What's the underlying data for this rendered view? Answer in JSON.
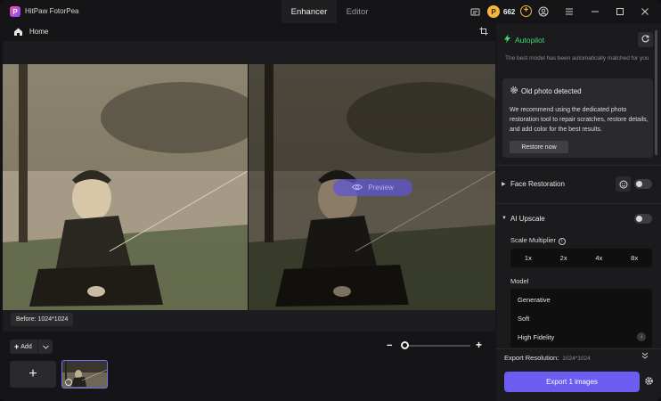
{
  "app": {
    "title": "HitPaw FotorPea"
  },
  "mode_tabs": [
    {
      "label": "Enhancer"
    },
    {
      "label": "Editor"
    }
  ],
  "credits": {
    "count": "662"
  },
  "home": {
    "label": "Home"
  },
  "canvas": {
    "before_label": "Before: 1024*1024",
    "preview_label": "Preview"
  },
  "tray": {
    "add_label": "Add"
  },
  "panel": {
    "autopilot": {
      "title": "Autopilot",
      "description": "The best model has been automatically matched for you"
    },
    "old_photo": {
      "title": "Old photo detected",
      "body": "We recommend using the dedicated photo restoration tool to repair scratches, restore details, and add color for the best results.",
      "button": "Restore now"
    },
    "face_restoration": {
      "label": "Face Restoration",
      "enabled": false
    },
    "ai_upscale": {
      "label": "AI Upscale",
      "enabled": false,
      "scale_label": "Scale Multiplier",
      "scale_options": [
        "1x",
        "2x",
        "4x",
        "8x"
      ],
      "model_label": "Model",
      "models": [
        "Generative",
        "Soft",
        "High Fidelity"
      ]
    },
    "export": {
      "resolution_label": "Export Resolution:",
      "resolution_value": "1024*1024",
      "button": "Export 1 images"
    }
  },
  "colors": {
    "accent": "#6c5cf0",
    "autopilot_green": "#3ddc6a",
    "coin_gold": "#f3b73a"
  },
  "icons": {
    "home": "home-icon",
    "crop": "crop-icon",
    "bolt": "bolt-icon",
    "refresh": "refresh-icon",
    "settings": "gear-icon",
    "eye": "eye-icon"
  }
}
